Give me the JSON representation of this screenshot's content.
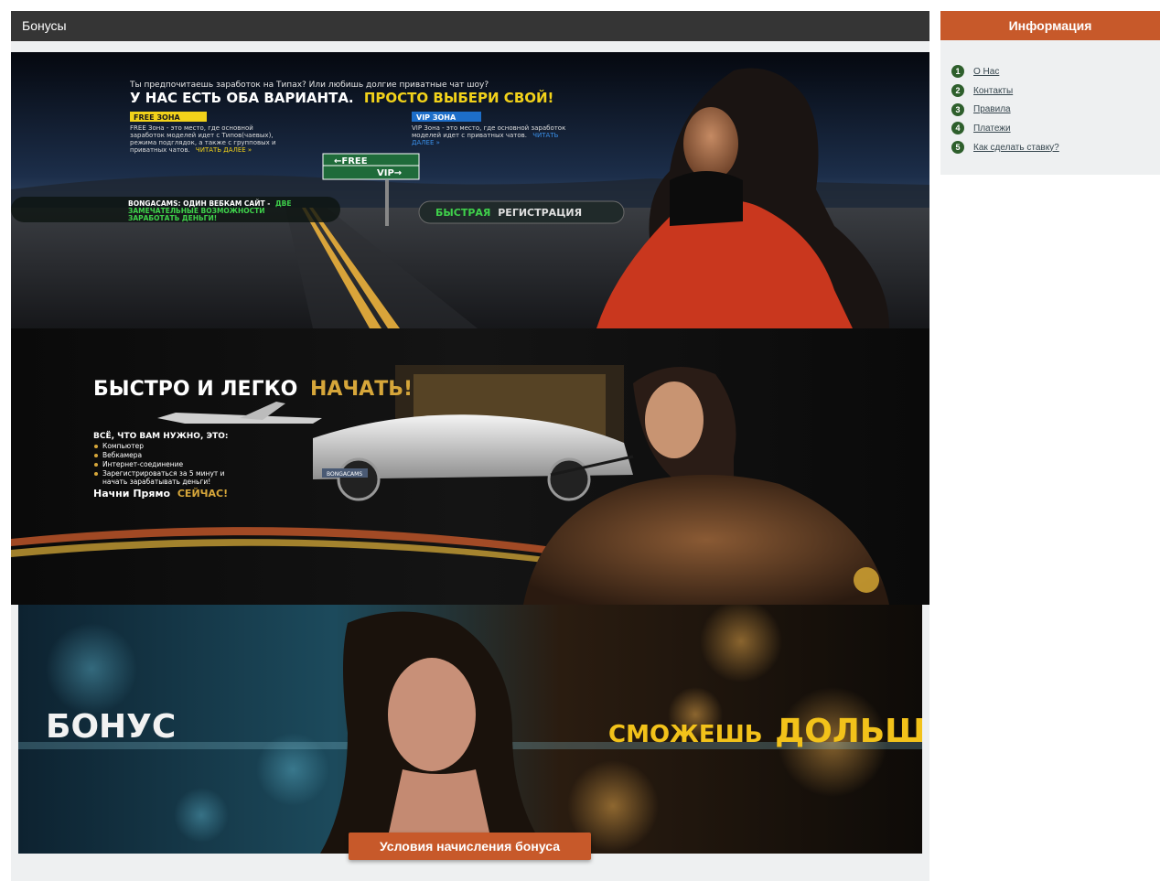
{
  "main": {
    "title": "Бонусы",
    "banner1": {
      "question": "Ты предпочитаешь заработок на Типах? Или любишь долгие приватные чат шоу?",
      "headline": "У НАС ЕСТЬ ОБА ВАРИАНТА.",
      "headline_accent": "ПРОСТО ВЫБЕРИ СВОЙ!",
      "free_label": "FREE ЗОНА",
      "free_text_1": "FREE Зона - это место, где основной",
      "free_text_2": "заработок моделей идет с Типов(чаевых),",
      "free_text_3": "режима подглядок, а также с групповых и",
      "free_text_4": "приватных чатов.",
      "free_link": "ЧИТАТЬ ДАЛЕЕ »",
      "vip_label": "VIP ЗОНА",
      "vip_text_1": "VIP Зона - это место, где основной заработок",
      "vip_text_2": "моделей идет с приватных чатов.",
      "vip_link_1": "ЧИТАТЬ",
      "vip_link_2": "ДАЛЕЕ »",
      "sign_free": "←FREE",
      "sign_vip": "VIP→",
      "tag_1": "BONGACAMS: ОДИН ВЕБКАМ САЙТ -",
      "tag_accent_1": "ДВЕ",
      "tag_2": "ЗАМЕЧАТЕЛЬНЫЕ ВОЗМОЖНОСТИ",
      "tag_3": "ЗАРАБОТАТЬ ДЕНЬГИ!",
      "reg_accent": "БЫСТРАЯ",
      "reg_rest": "РЕГИСТРАЦИЯ"
    },
    "banner2": {
      "headline": "БЫСТРО И ЛЕГКО",
      "headline_accent": "НАЧАТЬ!",
      "need": "ВСЁ, ЧТО ВАМ НУЖНО, ЭТО:",
      "items": [
        "Компьютер",
        "Вебкамера",
        "Интернет-соединение",
        "Зарегистрироваться за 5 минут и",
        "начать зарабатывать деньги!"
      ],
      "cta": "Начни Прямо",
      "cta_accent": "СЕЙЧАС!",
      "plate": "BONGACAMS"
    },
    "banner3": {
      "left": "БОНУС",
      "right_1": "СМОЖЕШЬ",
      "right_2": "ДОЛЬШЕ"
    },
    "bonus_button": "Условия начисления бонуса"
  },
  "sidebar": {
    "title": "Информация",
    "items": [
      {
        "num": "1",
        "label": "О Нас"
      },
      {
        "num": "2",
        "label": "Контакты"
      },
      {
        "num": "3",
        "label": "Правила"
      },
      {
        "num": "4",
        "label": "Платежи"
      },
      {
        "num": "5",
        "label": "Как сделать ставку?"
      }
    ]
  },
  "colors": {
    "header_bg": "#353535",
    "accent": "#c7592a",
    "number_badge": "#2e5f2c",
    "panel_bg": "#eef0f1",
    "banner_yellow": "#f2d21a",
    "banner_green": "#3fd14b"
  }
}
